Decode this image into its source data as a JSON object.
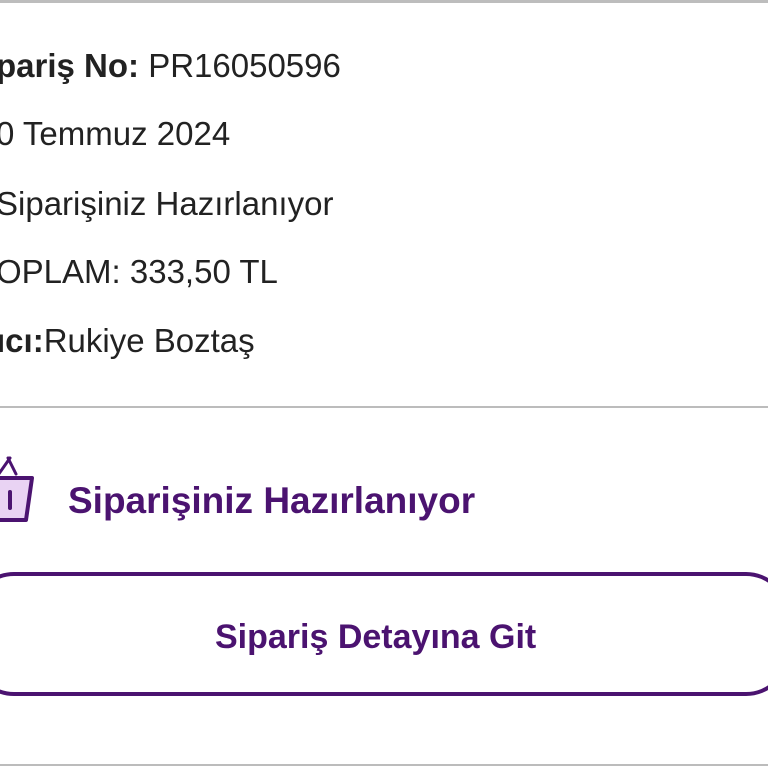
{
  "order": {
    "order_no_label": "pariş No:",
    "order_no_value": " PR16050596",
    "date": "0 Temmuz 2024",
    "status_line": "Siparişiniz Hazırlanıyor",
    "total_line": "OPLAM: 333,50 TL",
    "recipient_label": "ıcı:",
    "recipient_value": "Rukiye Boztaş"
  },
  "status_block": {
    "icon": "shopping-basket-icon",
    "text": "Siparişiniz Hazırlanıyor",
    "accent_color": "#4b1370"
  },
  "actions": {
    "detail_button_label": "Sipariş Detayına Git"
  }
}
